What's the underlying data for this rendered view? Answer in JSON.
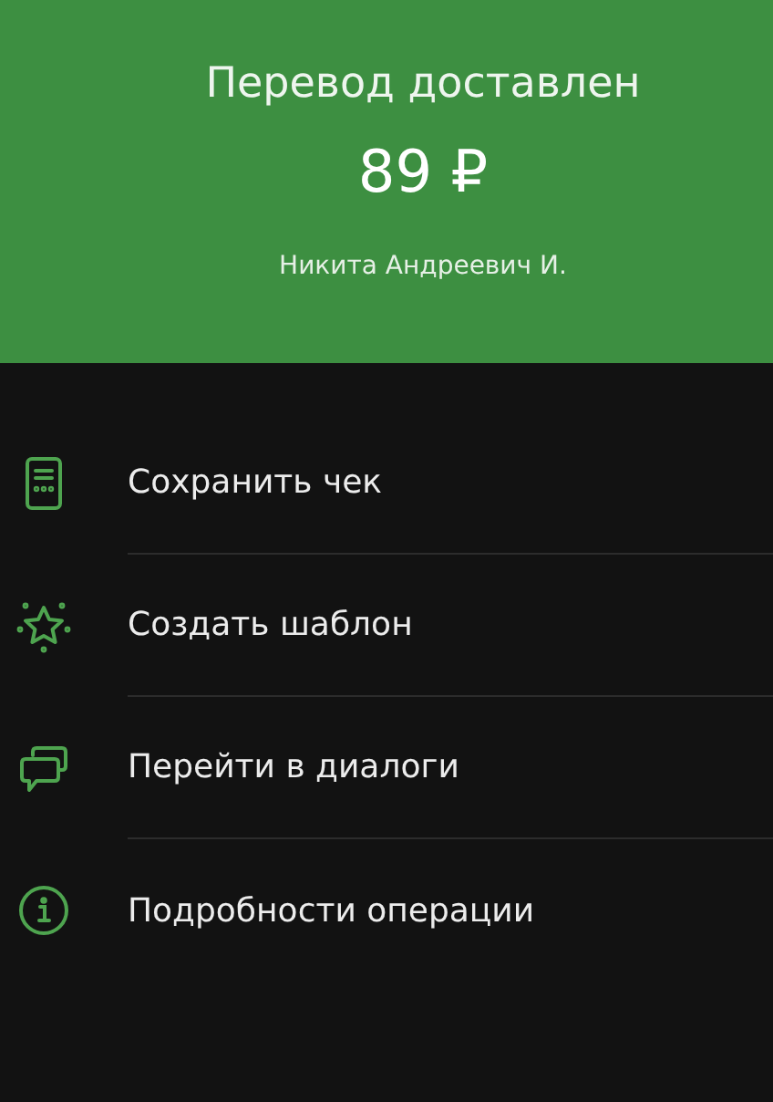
{
  "header": {
    "title": "Перевод доставлен",
    "amount": "89 ₽",
    "recipient": "Никита Андреевич И."
  },
  "actions": [
    {
      "kind": "receipt",
      "label": "Сохранить чек"
    },
    {
      "kind": "star",
      "label": "Создать шаблон"
    },
    {
      "kind": "chat",
      "label": "Перейти в диалоги"
    },
    {
      "kind": "info",
      "label": "Подробности операции"
    }
  ]
}
